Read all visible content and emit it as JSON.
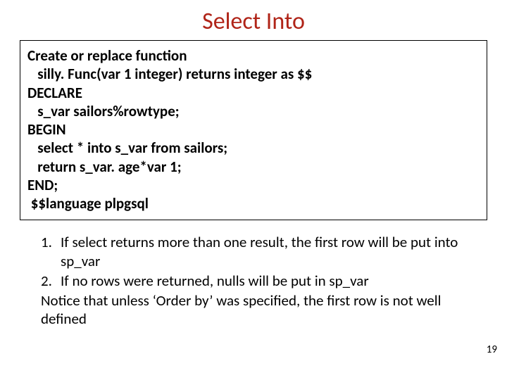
{
  "title": "Select Into",
  "code": {
    "l1": "Create or replace function",
    "l2": "   silly. Func(var 1 integer) returns integer as $$",
    "l3": "DECLARE",
    "l4": "   s_var sailors%rowtype;",
    "l5": "BEGIN",
    "l6": "   select * into s_var from sailors;",
    "l7": "   return s_var. age*var 1;",
    "l8": "END;",
    "l9": " $$language plpgsql"
  },
  "notes": {
    "item1_num": "1.",
    "item1": "If select returns more than one result, the first row will be put into sp_var",
    "item2_num": "2.",
    "item2": "If no rows were returned, nulls will be put in sp_var",
    "notice": "Notice that unless ‘Order by’ was specified, the first row is not well defined"
  },
  "page_number": "19"
}
